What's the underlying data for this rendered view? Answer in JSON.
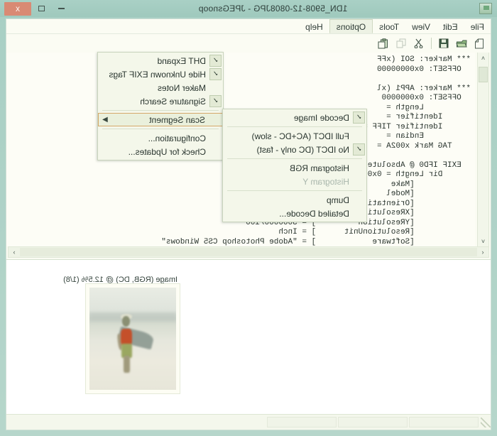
{
  "window": {
    "title": "1DN_5908-12-0808JPG - JPEGsnoop",
    "icon": "app-icon",
    "minimize_label": "",
    "maximize_label": "",
    "close_label": "x"
  },
  "menubar": {
    "items": [
      {
        "label": "File",
        "open": false
      },
      {
        "label": "Edit",
        "open": false
      },
      {
        "label": "View",
        "open": false
      },
      {
        "label": "Tools",
        "open": false
      },
      {
        "label": "Options",
        "open": true
      },
      {
        "label": "Help",
        "open": false
      }
    ]
  },
  "toolbar": {
    "buttons": [
      {
        "icon": "new-document-icon",
        "enabled": true
      },
      {
        "icon": "open-folder-icon",
        "enabled": true
      },
      {
        "icon": "save-floppy-icon",
        "enabled": true
      },
      {
        "icon": "cut-scissors-icon",
        "enabled": true
      },
      {
        "icon": "copy-icon",
        "enabled": false
      },
      {
        "icon": "paste-icon",
        "enabled": true
      }
    ]
  },
  "options_menu": {
    "items": [
      {
        "label": "DHT Expand",
        "checked": true,
        "submenu": false,
        "enabled": true
      },
      {
        "label": "Hide Unknown EXIF Tags",
        "checked": true,
        "submenu": false,
        "enabled": true
      },
      {
        "label": "Maker Notes",
        "checked": false,
        "submenu": false,
        "enabled": true
      },
      {
        "label": "Signature Search",
        "checked": true,
        "submenu": false,
        "enabled": true
      },
      {
        "label": "Scan Segment",
        "checked": false,
        "submenu": true,
        "enabled": true,
        "highlighted": true
      },
      {
        "label": "Configuration...",
        "checked": false,
        "submenu": false,
        "enabled": true
      },
      {
        "label": "Check for Updates...",
        "checked": false,
        "submenu": false,
        "enabled": true
      }
    ]
  },
  "scan_submenu": {
    "items": [
      {
        "label": "Decode Image",
        "checked": true,
        "enabled": true
      },
      {
        "label": "Full IDCT (AC+DC - slow)",
        "checked": false,
        "enabled": true
      },
      {
        "label": "No IDCT (DC only - fast)",
        "checked": true,
        "enabled": true
      },
      {
        "label": "Histogram RGB",
        "checked": false,
        "enabled": true
      },
      {
        "label": "Histogram Y",
        "checked": false,
        "enabled": false
      },
      {
        "label": "Dump",
        "checked": false,
        "enabled": true
      },
      {
        "label": "Detailed Decode...",
        "checked": false,
        "enabled": true
      }
    ]
  },
  "report": {
    "text": "*** Marker: SOI (xFF\n  OFFSET: 0x00000000\n\n*** Marker: APP1 (xl\n  OFFSET: 0x0000000\n          Length =\n      Identifier =\n      Identifier TIFF =\n          Endian =\n    TAG Mark x002A =\n\n  EXIF IFD0 @ Absolute 0x00000014\n      Dir Length = 0x0010\n            [Make                ] = \"Canon\n            [Model               ] = \"Canon\n            [Orientation         ] = Row 0:\n            [XResolution         ] = 3000000\n            [YResolution         ] = 3000000/100\n            [ResolutionUnit      ] = Inch\n            [Software            ] = \"Adobe Photoshop CS5 Windows\""
  },
  "scrollbars": {
    "vertical": {
      "up_glyph": "˄",
      "down_glyph": "˅"
    },
    "horizontal": {
      "left_glyph": "‹",
      "right_glyph": "›"
    }
  },
  "image_pane": {
    "caption": "Image (RGB, DC) @ 12.5% (1/8)",
    "photo_alt": "beach-photo"
  },
  "statusbar": {
    "panes": [
      "",
      "",
      "",
      ""
    ]
  },
  "colors": {
    "window_frame": "#a8cfc4",
    "client_background": "#fbfcf5",
    "menu_background": "#f4f7ea",
    "menu_highlight_border": "#d6a86a",
    "close_button": "#d98a74",
    "text": "#2a352f",
    "disabled_text": "#a9b6ac"
  }
}
